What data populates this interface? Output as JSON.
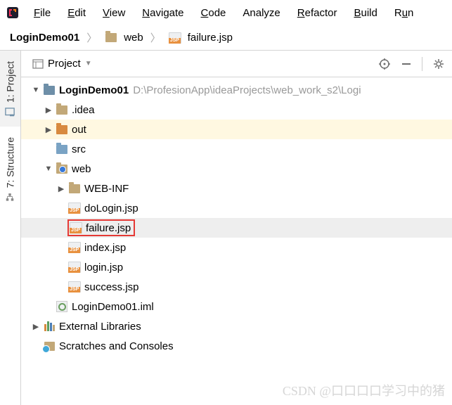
{
  "menu": {
    "file": "File",
    "edit": "Edit",
    "view": "View",
    "navigate": "Navigate",
    "code": "Code",
    "analyze": "Analyze",
    "refactor": "Refactor",
    "build": "Build",
    "run": "Run"
  },
  "breadcrumb": {
    "root": "LoginDemo01",
    "folder": "web",
    "file": "failure.jsp"
  },
  "panel": {
    "title": "Project"
  },
  "sideTabs": {
    "project": "1: Project",
    "structure": "7: Structure"
  },
  "tree": {
    "root": {
      "name": "LoginDemo01",
      "path": "D:\\ProfesionApp\\ideaProjects\\web_work_s2\\Logi"
    },
    "idea": ".idea",
    "out": "out",
    "src": "src",
    "web": "web",
    "webinf": "WEB-INF",
    "dologin": "doLogin.jsp",
    "failure": "failure.jsp",
    "index": "index.jsp",
    "login": "login.jsp",
    "success": "success.jsp",
    "iml": "LoginDemo01.iml",
    "extLib": "External Libraries",
    "scratches": "Scratches and Consoles"
  },
  "watermark": "CSDN @口口口口学习中的猪"
}
